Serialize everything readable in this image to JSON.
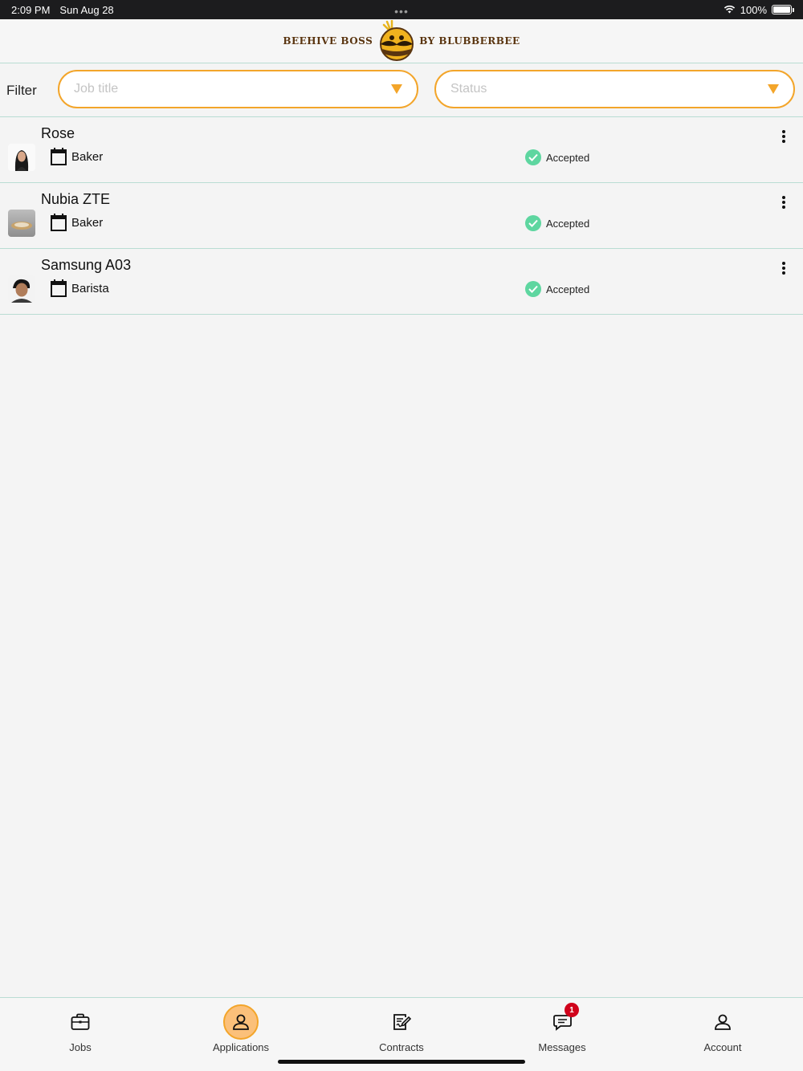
{
  "status_bar": {
    "time": "2:09 PM",
    "date": "Sun Aug 28",
    "battery": "100%",
    "wifi_icon": "wifi-icon"
  },
  "header": {
    "logo_left": "BEEHIVE BOSS",
    "logo_right": "BY BLUBBERBEE"
  },
  "filter": {
    "label": "Filter",
    "job_title_placeholder": "Job title",
    "status_placeholder": "Status",
    "accent_color": "#f3a52a"
  },
  "applications": [
    {
      "name": "Rose",
      "job": "Baker",
      "status": "Accepted"
    },
    {
      "name": "Nubia ZTE",
      "job": "Baker",
      "status": "Accepted"
    },
    {
      "name": "Samsung A03",
      "job": "Barista",
      "status": "Accepted"
    }
  ],
  "tabs": [
    {
      "label": "Jobs",
      "icon": "briefcase-icon"
    },
    {
      "label": "Applications",
      "icon": "person-icon",
      "active": true
    },
    {
      "label": "Contracts",
      "icon": "contract-edit-icon"
    },
    {
      "label": "Messages",
      "icon": "chat-icon",
      "badge": "1"
    },
    {
      "label": "Account",
      "icon": "account-icon"
    }
  ],
  "colors": {
    "status_accepted": "#5ed6a0",
    "divider": "#b9dcd3",
    "badge": "#d0021b"
  }
}
